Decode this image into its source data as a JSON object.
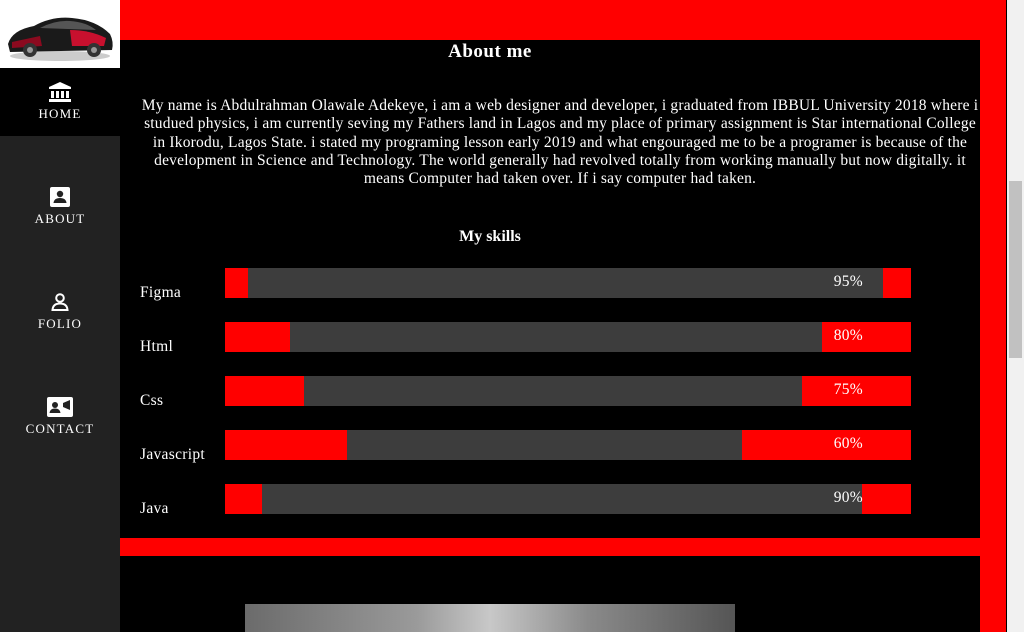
{
  "sidebar": {
    "logo_alt": "car logo",
    "items": [
      {
        "label": "HOME",
        "icon": "bank-icon",
        "active": true
      },
      {
        "label": "ABOUT",
        "icon": "contact-card-icon"
      },
      {
        "label": "FOLIO",
        "icon": "person-icon"
      },
      {
        "label": "CONTACT",
        "icon": "video-chat-icon"
      }
    ]
  },
  "about": {
    "title": "About me",
    "text": "My name is Abdulrahman Olawale Adekeye, i am a web designer and developer, i graduated from IBBUL University 2018 where i studued physics, i am currently seving my Fathers land in Lagos and my place of primary assignment is Star international College in Ikorodu, Lagos State. i stated my programing lesson early 2019 and what engouraged me to be a programer is because of the development in Science and Technology. The world generally had revolved totally from working manually but now digitally. it means Computer had taken over. If i say computer had taken."
  },
  "skills": {
    "title": "My skills",
    "items": [
      {
        "name": "Figma",
        "percent_label": "95%",
        "value": 95
      },
      {
        "name": "Html",
        "percent_label": "80%",
        "value": 80
      },
      {
        "name": "Css",
        "percent_label": "75%",
        "value": 75
      },
      {
        "name": "Javascript",
        "percent_label": "60%",
        "value": 60
      },
      {
        "name": "Java",
        "percent_label": "90%",
        "value": 90
      }
    ]
  },
  "colors": {
    "accent": "#ff0000",
    "sidebar_bg": "#222222",
    "bar_track": "#3d3d3d",
    "background": "#000000"
  }
}
